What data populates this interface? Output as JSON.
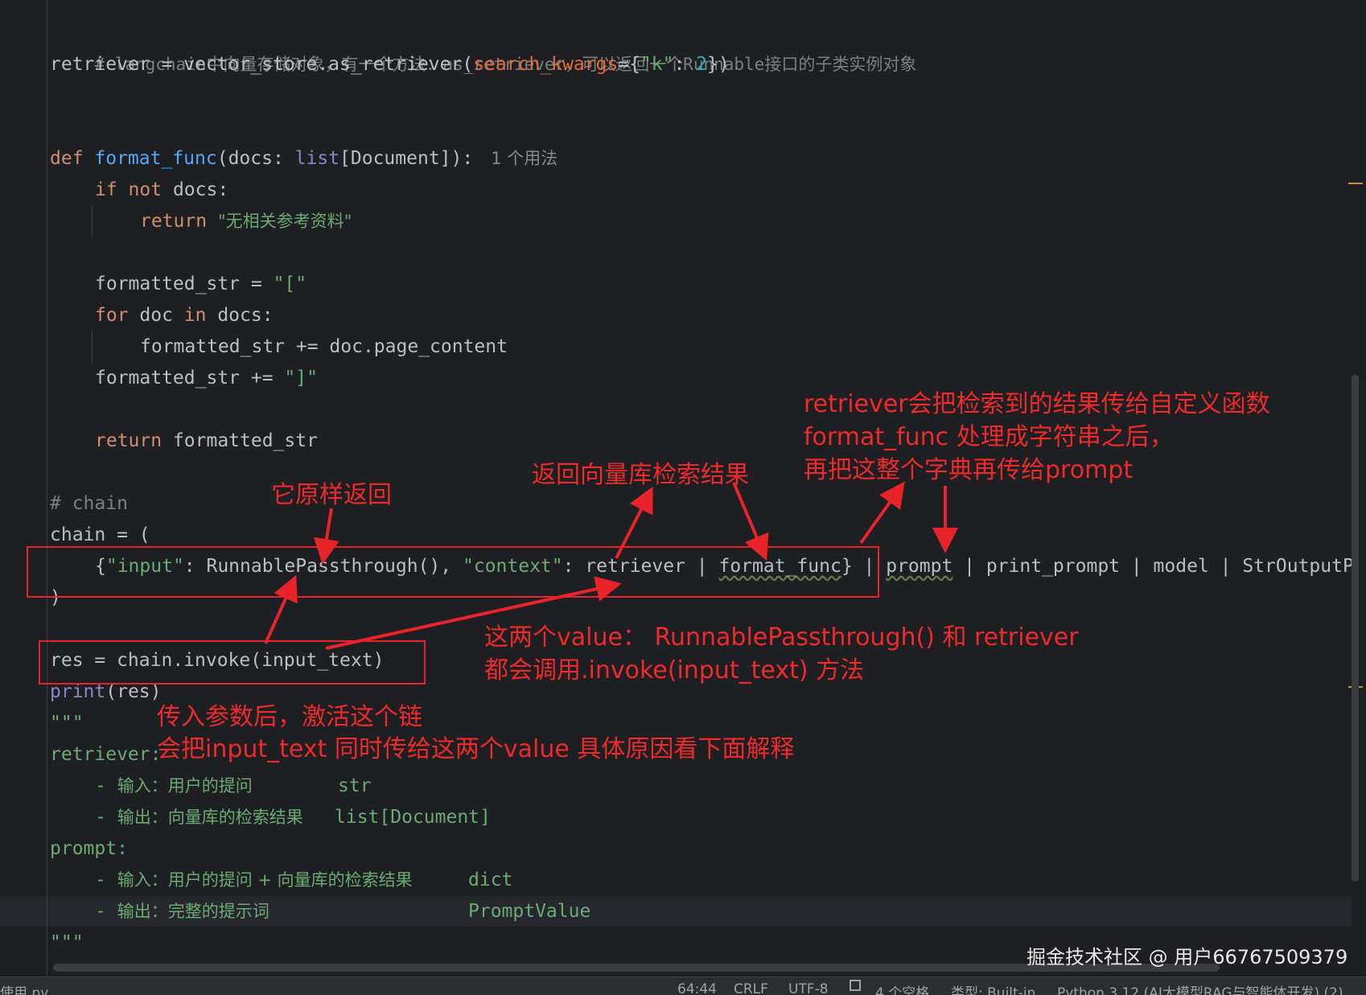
{
  "code": {
    "l1_comment": "# langchain中向量存储对象，有一个方法：as_retriever，可以返回一个Runnable接口的子类实例对象",
    "l2_lhs": "retriever = vector_store.as_retriever(",
    "l2_param": "search_kwargs",
    "l2_eq": "={",
    "l2_key": "\"k\"",
    "l2_colon": ": ",
    "l2_num": "2",
    "l2_end": "})",
    "l3_def": "def ",
    "l3_fn": "format_func",
    "l3_args_a": "(docs: ",
    "l3_list": "list",
    "l3_args_b": "[Document]):",
    "l3_hint": "1 个用法",
    "l4_if": "if ",
    "l4_not": "not ",
    "l4_rest": "docs:",
    "l5_return": "return ",
    "l5_str": "\"无相关参考资料\"",
    "l6_lhs": "formatted_str = ",
    "l6_str": "\"[\"",
    "l7_for": "for ",
    "l7_doc": "doc ",
    "l7_in": "in ",
    "l7_rest": "docs:",
    "l8": "formatted_str += doc.page_content",
    "l9_lhs": "formatted_str += ",
    "l9_str": "\"]\"",
    "l10_return": "return ",
    "l10_rest": "formatted_str",
    "l11_comment": "# chain",
    "l12": "chain = (",
    "l13_a": "{",
    "l13_key1": "\"input\"",
    "l13_b": ": RunnablePassthrough(), ",
    "l13_key2": "\"context\"",
    "l13_c": ": retriever | ",
    "l13_fn": "format_func",
    "l13_d": "}",
    "l13_e": " | ",
    "l13_prompt": "prompt",
    "l13_f": " | print_prompt | model | StrOutputP",
    "l14": ")",
    "l15": "res = chain.invoke(input_text)",
    "l16_print": "print",
    "l16_rest": "(res)",
    "l17": "\"\"\"",
    "l18": "retriever:",
    "l19_dash": "- ",
    "l19_cn": "输入：用户的提问",
    "l19_type": "str",
    "l20_dash": "- ",
    "l20_cn": "输出：向量库的检索结果",
    "l20_type": "list[Document]",
    "l21": "prompt:",
    "l22_dash": "- ",
    "l22_cn": "输入：用户的提问 + 向量库的检索结果",
    "l22_type": "dict",
    "l23_dash": "- ",
    "l23_cn": "输出：完整的提示词",
    "l23_type": "PromptValue",
    "l24": "\"\"\""
  },
  "annotations": {
    "passthrough_note": "它原样返回",
    "retriever_note": "返回向量库检索结果",
    "format_note_1": "retriever会把检索到的结果传给自定义函数",
    "format_note_2": "format_func 处理成字符串之后，",
    "format_note_3": "再把这整个字典再传给prompt",
    "values_note_1": "这两个value：  RunnablePassthrough() 和 retriever",
    "values_note_2": "都会调用.invoke(input_text) 方法",
    "invoke_note_1": "传入参数后，激活这个链",
    "invoke_note_2": "会把input_text 同时传给这两个value 具体原因看下面解释"
  },
  "watermark": "掘金技术社区 @ 用户66767509379",
  "statusbar": {
    "file": "使用.py",
    "position": "64:44",
    "line_ending": "CRLF",
    "encoding": "UTF-8",
    "indent": "4 个空格",
    "type": "类型: Built-in",
    "interpreter": "Python 3.12 (AI大模型RAG与智能体开发) (2)"
  },
  "colors": {
    "annotation_red": "#e8232a",
    "editor_bg": "#1e1f22",
    "keyword": "#cf8e6d",
    "function": "#56a8f5",
    "string": "#6aab73"
  }
}
